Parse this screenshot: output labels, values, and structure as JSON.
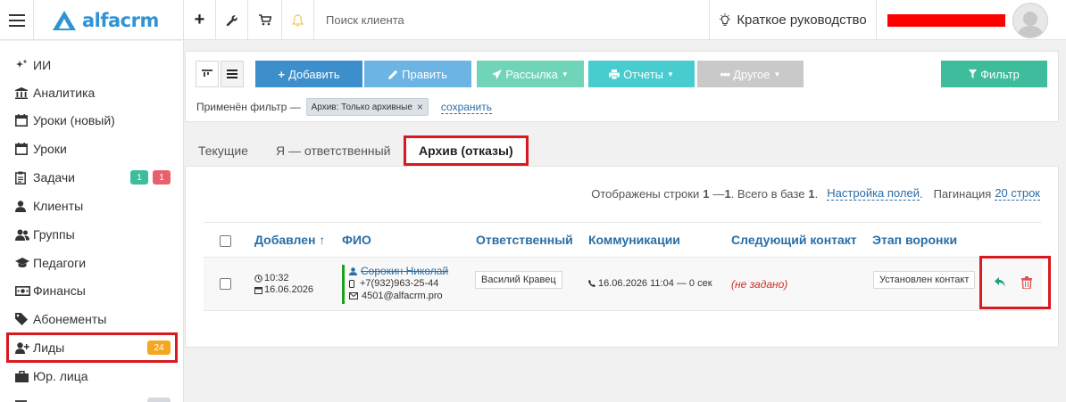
{
  "topbar": {
    "logo_text": "alfacrm",
    "search_placeholder": "Поиск клиента",
    "guide_label": "Краткое руководство",
    "add_icon": "plus-icon",
    "settings_icon": "wrench-icon",
    "cart_icon": "cart-icon",
    "notifications_icon": "bell-icon",
    "brand_color": "#2f93d4"
  },
  "sidebar": {
    "items": [
      {
        "label": "ИИ",
        "icon": "sparkle-icon"
      },
      {
        "label": "Аналитика",
        "icon": "columns-icon"
      },
      {
        "label": "Уроки (новый)",
        "icon": "calendar-icon"
      },
      {
        "label": "Уроки",
        "icon": "calendar-icon"
      },
      {
        "label": "Задачи",
        "icon": "clipboard-icon",
        "badges": [
          "1",
          "1"
        ]
      },
      {
        "label": "Клиенты",
        "icon": "user-icon"
      },
      {
        "label": "Группы",
        "icon": "users-icon"
      },
      {
        "label": "Педагоги",
        "icon": "graduation-cap-icon"
      },
      {
        "label": "Финансы",
        "icon": "money-icon"
      },
      {
        "label": "Абонементы",
        "icon": "tag-icon"
      },
      {
        "label": "Лиды",
        "icon": "user-plus-icon",
        "badge": "24"
      },
      {
        "label": "Юр. лица",
        "icon": "briefcase-icon"
      }
    ]
  },
  "toolbar": {
    "add_label": "Добавить",
    "edit_label": "Править",
    "mailing_label": "Рассылка",
    "reports_label": "Отчеты",
    "other_label": "Другое",
    "filter_label": "Фильтр",
    "filter_applied_label": "Применён фильтр —",
    "filter_chip": "Архив: Только архивные",
    "save_label": "сохранить",
    "colors": {
      "add": "#3d8fcc",
      "edit": "#6cb4e4",
      "mailing": "#6fd4b8",
      "reports": "#47ccd0",
      "other": "#c9c9c9",
      "filter": "#3dbd9c"
    }
  },
  "tabs": [
    "Текущие",
    "Я — ответственный",
    "Архив (отказы)"
  ],
  "active_tab": "Архив (отказы)",
  "info": {
    "shown_prefix": "Отображены строки",
    "range_from": "1",
    "range_dash": "—",
    "range_to": "1",
    "total_prefix": ". Всего в базе",
    "total": "1",
    "total_suffix": ".",
    "fields_link": "Настройка полей",
    "pagination_label": "Пагинация",
    "pagination_value": "20 строк"
  },
  "table": {
    "headers": [
      "Добавлен ↑",
      "ФИО",
      "Ответственный",
      "Коммуникации",
      "Следующий контакт",
      "Этап воронки"
    ],
    "row": {
      "time": "10:32",
      "date": "16.06.2026",
      "name": "Сорокин Николай",
      "phone": "+7(932)963-25-44",
      "email": "4501@alfacrm.pro",
      "responsible": "Василий Кравец",
      "communication": "16.06.2026 11:04 — 0 сек",
      "next_contact": "(не задано)",
      "stage": "Установлен контакт"
    }
  }
}
